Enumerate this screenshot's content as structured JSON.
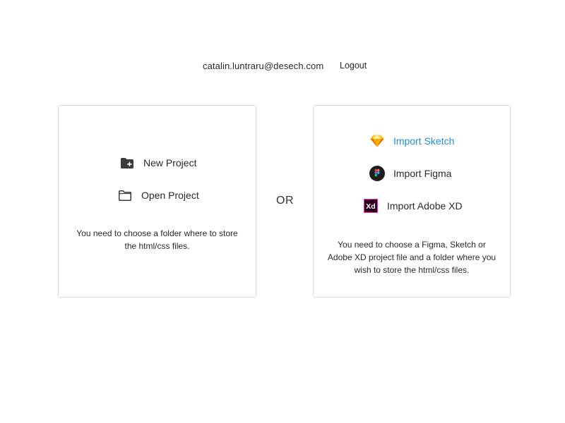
{
  "header": {
    "email": "catalin.luntraru@desech.com",
    "logout_label": "Logout"
  },
  "left_card": {
    "new_project_label": "New Project",
    "open_project_label": "Open Project",
    "note": "You need to choose a folder where to store the html/css files."
  },
  "separator": {
    "label": "OR"
  },
  "right_card": {
    "import_sketch_label": "Import Sketch",
    "import_figma_label": "Import Figma",
    "import_xd_label": "Import Adobe XD",
    "note": "You need to choose a Figma, Sketch or Adobe XD project file and a folder where you wish to store the html/css files."
  },
  "icons": {
    "new_project": "folder-plus-icon",
    "open_project": "folder-open-icon",
    "sketch": "sketch-logo-icon",
    "figma": "figma-logo-icon",
    "xd": "adobe-xd-logo-icon"
  },
  "colors": {
    "accent": "#1f8fe0",
    "text": "#2a2a2a",
    "border": "#dcdcdc"
  }
}
